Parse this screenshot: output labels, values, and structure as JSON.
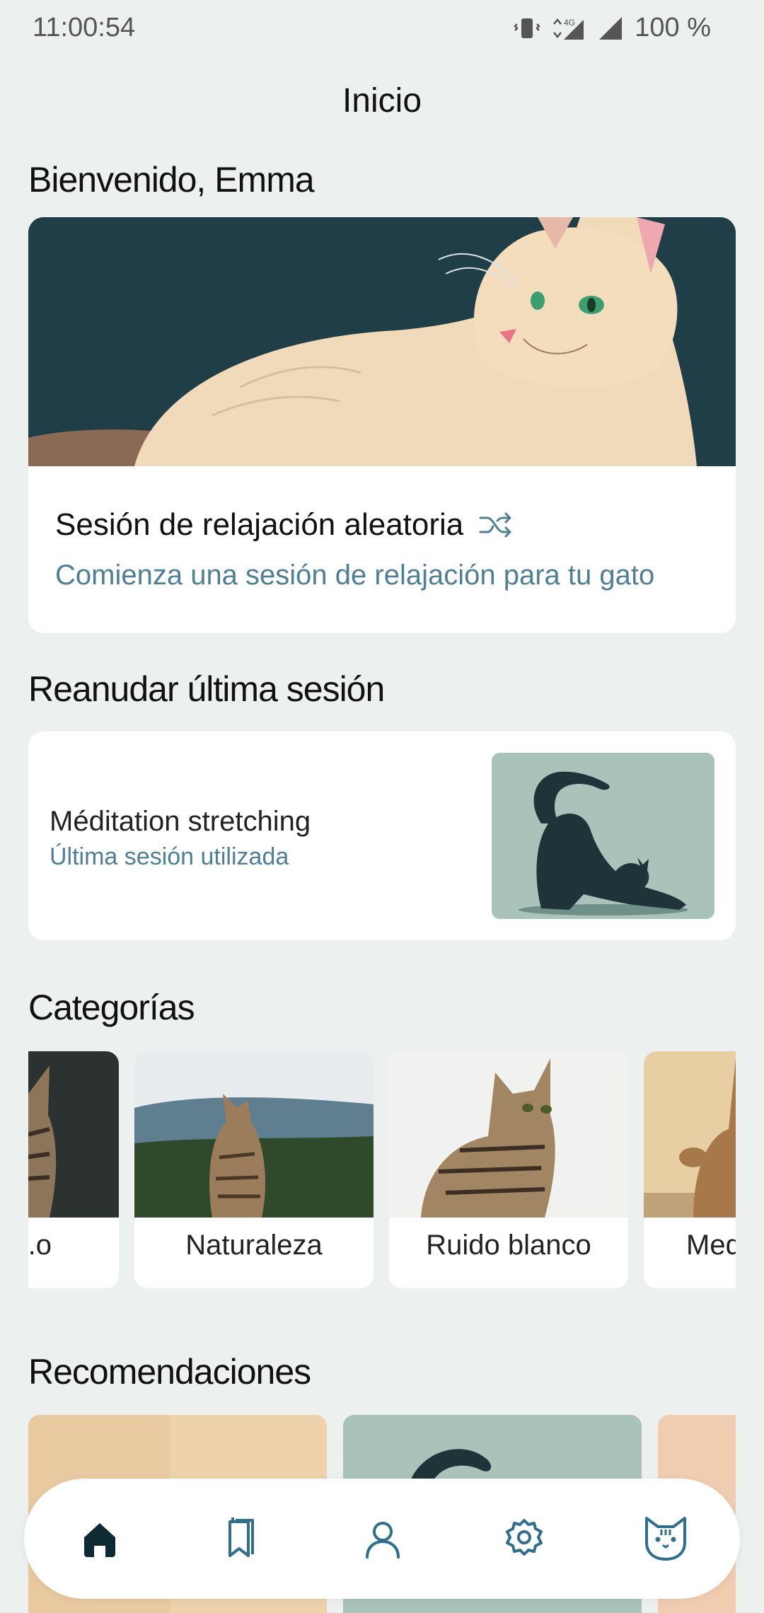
{
  "status": {
    "time": "11:00:54",
    "network": "4G",
    "battery": "100 %"
  },
  "header": {
    "title": "Inicio"
  },
  "welcome": "Bienvenido, Emma",
  "hero": {
    "title": "Sesión de relajación aleatoria",
    "subtitle": "Comienza una sesión de relajación para tu gato",
    "icon": "shuffle-icon"
  },
  "resume": {
    "section_title": "Reanudar última sesión",
    "item_title": "Méditation stretching",
    "item_subtitle": "Última sesión utilizada"
  },
  "categories": {
    "section_title": "Categorías",
    "items": [
      {
        "label": "...o"
      },
      {
        "label": "Naturaleza"
      },
      {
        "label": "Ruido blanco"
      },
      {
        "label": "Med"
      }
    ]
  },
  "recommendations": {
    "section_title": "Recomendaciones"
  },
  "nav": {
    "items": [
      {
        "icon": "home-icon",
        "active": true
      },
      {
        "icon": "bookmarks-icon",
        "active": false
      },
      {
        "icon": "profile-icon",
        "active": false
      },
      {
        "icon": "settings-icon",
        "active": false
      },
      {
        "icon": "cat-face-icon",
        "active": false
      }
    ]
  },
  "colors": {
    "background": "#ECF0EF",
    "accent_text": "#4F7F95",
    "nav_icon": "#2E6E8E",
    "nav_active": "#0E2A33",
    "hero_bg": "#1F3E47"
  }
}
